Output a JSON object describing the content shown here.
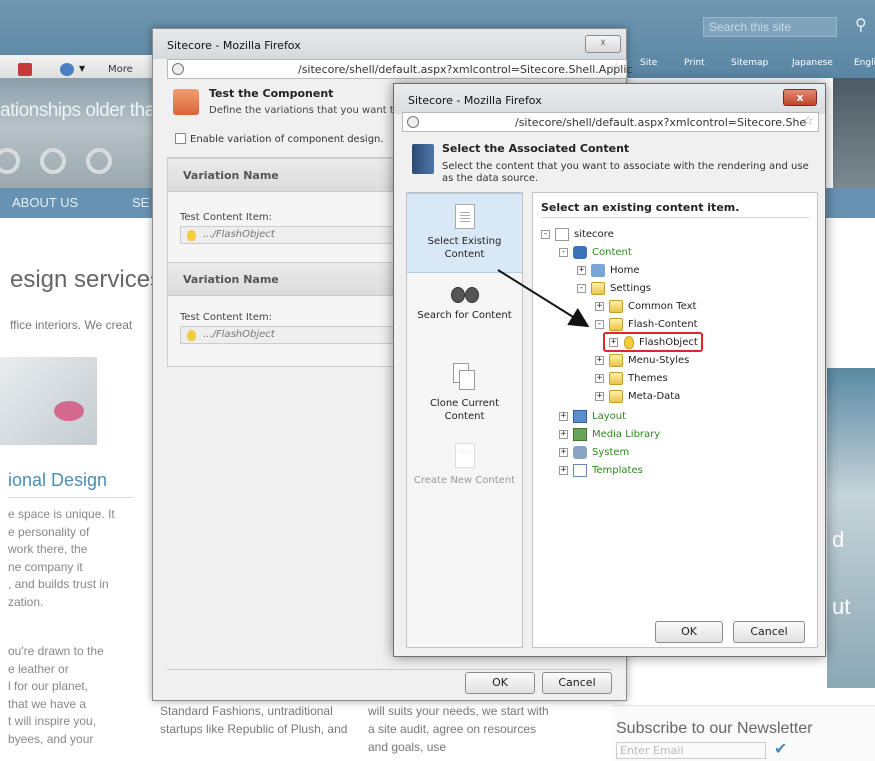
{
  "website": {
    "search_placeholder": "Search this site",
    "more_label": "More",
    "links": [
      "Site",
      "Print",
      "Sitemap",
      "Japanese",
      "English"
    ],
    "hero_text": "ationships older tha",
    "nav": [
      "ABOUT US",
      "SE"
    ],
    "heading": "esign services",
    "subheading": "ffice interiors. We creat",
    "section_title": "ional Design",
    "paragraph1": "e space is unique. It\ne personality of\nwork there, the\nne company it\n, and builds trust in\nzation.",
    "paragraph2": "ou're drawn to the\ne leather or\nl for our planet,\nthat we have a\nt will inspire you,\nbyees, and your",
    "col2": "Standard Fashions,\nuntraditional startups like\nRepublic of Plush, and",
    "col3": "will suits your needs, we start\nwith a site audit, agree on\nresources and goals, use",
    "right_letter_1": "d",
    "right_letter_2": "ut",
    "newsletter_title": "Subscribe to our Newsletter",
    "newsletter_placeholder": "Enter Email"
  },
  "outer_dialog": {
    "window_title": "Sitecore - Mozilla Firefox",
    "url": "/sitecore/shell/default.aspx?xmlcontrol=Sitecore.Shell.Applic",
    "header_title": "Test the Component",
    "header_desc": "Define the variations that you want to",
    "enable_checkbox_label": "Enable variation of component design.",
    "variations": [
      {
        "header": "Variation Name",
        "field_label": "Test Content Item:",
        "field_value": ".../FlashObject"
      },
      {
        "header": "Variation Name",
        "field_label": "Test Content Item:",
        "field_value": ".../FlashObject"
      }
    ],
    "ok_label": "OK",
    "cancel_label": "Cancel"
  },
  "inner_dialog": {
    "window_title": "Sitecore - Mozilla Firefox",
    "close_label": "x",
    "url": "/sitecore/shell/default.aspx?xmlcontrol=Sitecore.She",
    "header_title": "Select the Associated Content",
    "header_desc": "Select the content that you want to associate with the rendering and use as the data source.",
    "options": [
      {
        "label": "Select Existing Content",
        "icon": "document-icon",
        "active": true
      },
      {
        "label": "Search for Content",
        "icon": "binoculars-icon",
        "active": false
      },
      {
        "label": "Clone Current Content",
        "icon": "clone-icon",
        "active": false
      },
      {
        "label": "Create New Content",
        "icon": "new-document-icon",
        "disabled": true
      }
    ],
    "tree_heading": "Select an existing content item.",
    "tree": {
      "sitecore": "sitecore",
      "content": "Content",
      "home": "Home",
      "settings": "Settings",
      "common_text": "Common Text",
      "flash_content": "Flash-Content",
      "flash_object": "FlashObject",
      "menu_styles": "Menu-Styles",
      "themes": "Themes",
      "meta_data": "Meta-Data",
      "layout": "Layout",
      "media_library": "Media Library",
      "system": "System",
      "templates": "Templates"
    },
    "ok_label": "OK",
    "cancel_label": "Cancel"
  },
  "colors": {
    "selection_highlight": "#e0242e",
    "green_text": "#2c8a1c",
    "site_blue": "#6892b1"
  }
}
